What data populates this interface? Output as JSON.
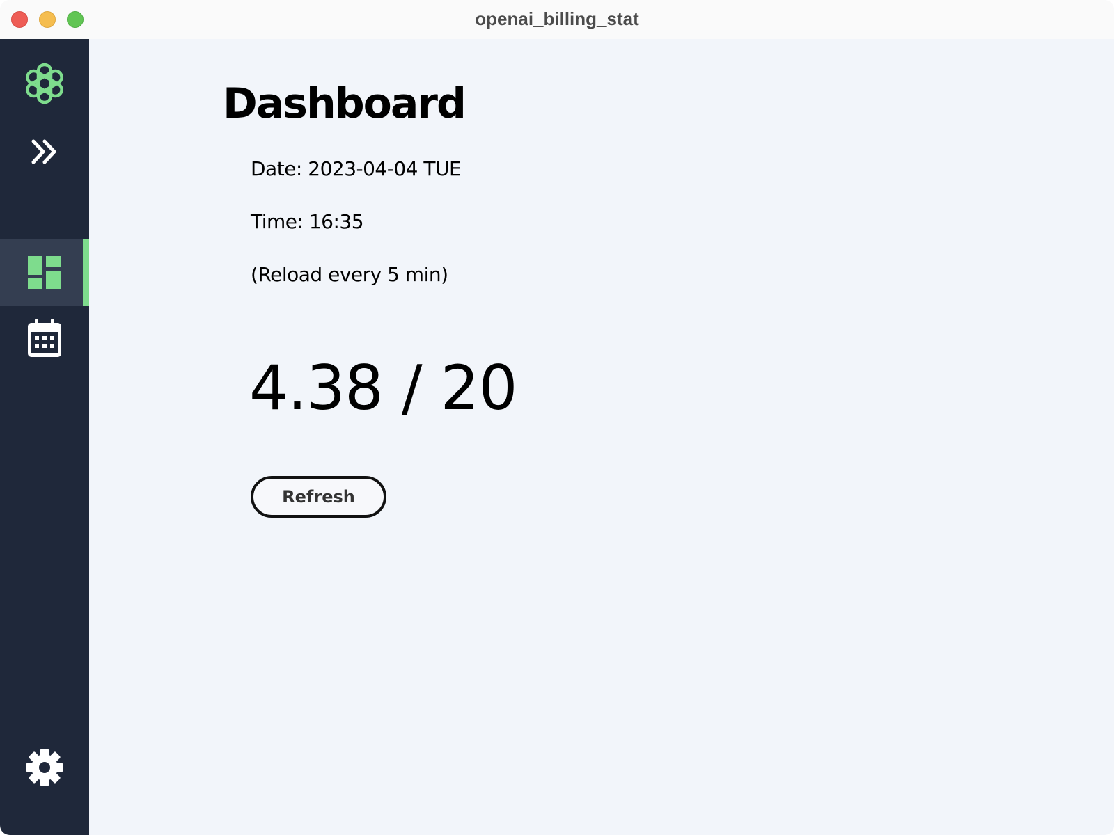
{
  "window": {
    "title": "openai_billing_stat"
  },
  "sidebar": {
    "items": [
      {
        "icon": "openai-logo-icon"
      },
      {
        "icon": "expand-chevrons-icon"
      },
      {
        "icon": "dashboard-icon",
        "active": true
      },
      {
        "icon": "calendar-icon"
      },
      {
        "icon": "gear-icon"
      }
    ]
  },
  "dashboard": {
    "title": "Dashboard",
    "date_line": "Date: 2023-04-04 TUE",
    "time_line": "Time: 16:35",
    "reload_note": "(Reload every 5 min)",
    "usage": {
      "used": "4.38",
      "separator": " / ",
      "limit": "20"
    },
    "refresh_label": "Refresh"
  },
  "colors": {
    "sidebar_bg": "#1f283a",
    "sidebar_active_bg": "#343e51",
    "accent_green": "#7edc8d",
    "main_bg": "#f2f5fa"
  }
}
